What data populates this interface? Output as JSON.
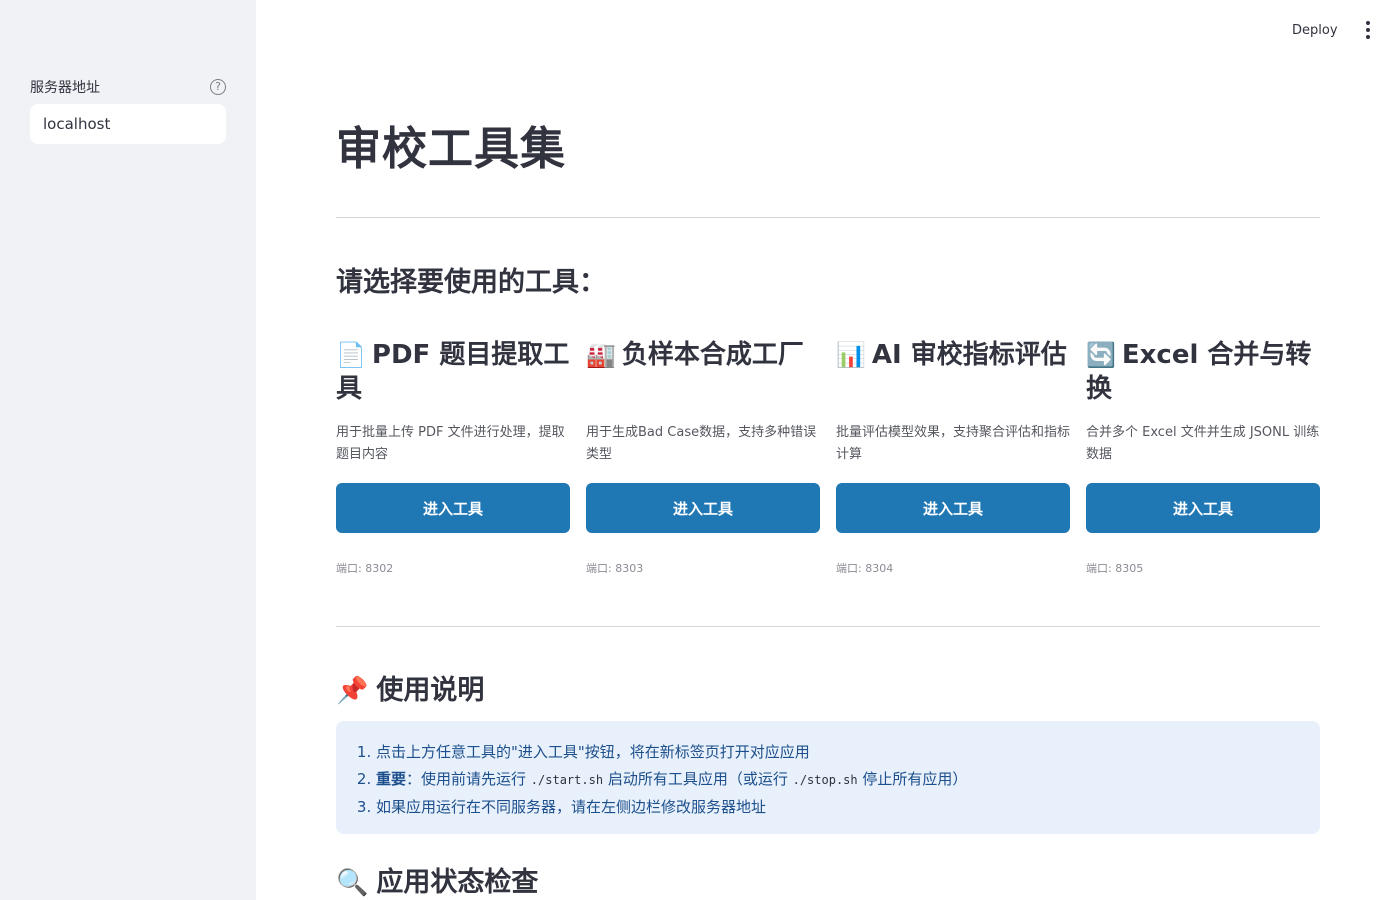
{
  "sidebar": {
    "server_label": "服务器地址",
    "help_icon": "?",
    "server_value": "localhost"
  },
  "header": {
    "deploy_label": "Deploy",
    "menu_icon": "more-vertical-icon"
  },
  "main": {
    "title": "审校工具集",
    "subtitle": "请选择要使用的工具：",
    "button_label": "进入工具",
    "tools": [
      {
        "emoji": "📄",
        "icon": "document-icon",
        "title": "PDF 题目提取工具",
        "desc": "用于批量上传 PDF 文件进行处理，提取题目内容",
        "port": "端口: 8302"
      },
      {
        "emoji": "🏭",
        "icon": "factory-icon",
        "title": "负样本合成工厂",
        "desc": "用于生成Bad Case数据，支持多种错误类型",
        "port": "端口: 8303"
      },
      {
        "emoji": "📊",
        "icon": "bar-chart-icon",
        "title": "AI 审校指标评估",
        "desc": "批量评估模型效果，支持聚合评估和指标计算",
        "port": "端口: 8304"
      },
      {
        "emoji": "🔄",
        "icon": "refresh-icon",
        "title": "Excel 合并与转换",
        "desc": "合并多个 Excel 文件并生成 JSONL 训练数据",
        "port": "端口: 8305"
      }
    ],
    "usage": {
      "emoji": "📌",
      "icon": "pushpin-icon",
      "heading": "使用说明",
      "item1": "点击上方任意工具的\"进入工具\"按钮，将在新标签页打开对应应用",
      "item2_bold": "重要",
      "item2_a": "：使用前请先运行 ",
      "item2_code1": "./start.sh",
      "item2_b": " 启动所有工具应用（或运行 ",
      "item2_code2": "./stop.sh",
      "item2_c": " 停止所有应用）",
      "item3": "如果应用运行在不同服务器，请在左侧边栏修改服务器地址"
    },
    "status": {
      "emoji": "🔍",
      "icon": "magnifier-icon",
      "heading": "应用状态检查"
    }
  }
}
